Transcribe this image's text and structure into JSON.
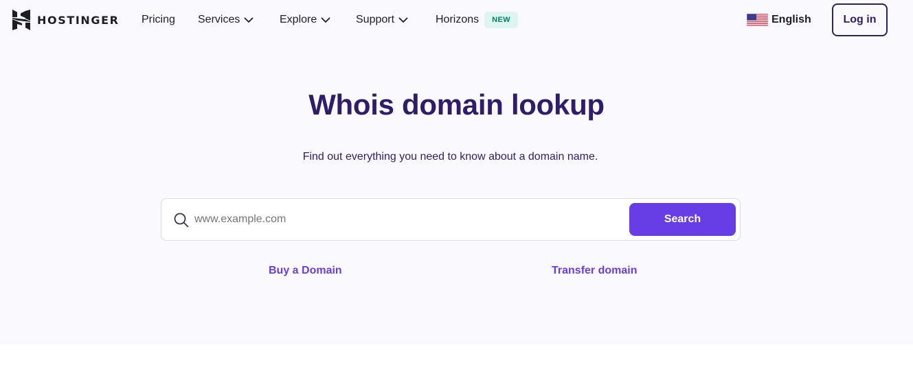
{
  "brand": {
    "name": "HOSTINGER",
    "text_color": "#1d1e20"
  },
  "nav": {
    "items": [
      {
        "label": "Pricing",
        "has_dropdown": false
      },
      {
        "label": "Services",
        "has_dropdown": true
      },
      {
        "label": "Explore",
        "has_dropdown": true
      },
      {
        "label": "Support",
        "has_dropdown": true
      },
      {
        "label": "Horizons",
        "has_dropdown": false,
        "badge": "NEW"
      }
    ],
    "language": {
      "label": "English",
      "icon": "us-flag-icon"
    },
    "login_label": "Log in"
  },
  "hero": {
    "title": "Whois domain lookup",
    "subtitle": "Find out everything you need to know about a domain name.",
    "search": {
      "placeholder": "www.example.com",
      "value": "",
      "icon": "search-icon",
      "button_label": "Search"
    },
    "links": [
      {
        "label": "Buy a Domain"
      },
      {
        "label": "Transfer domain"
      }
    ]
  },
  "colors": {
    "primary": "#673de6",
    "dark_text": "#2f1c6a",
    "hero_background": "#f9f9fe",
    "badge_background": "#def4f0",
    "badge_text": "#008361"
  }
}
